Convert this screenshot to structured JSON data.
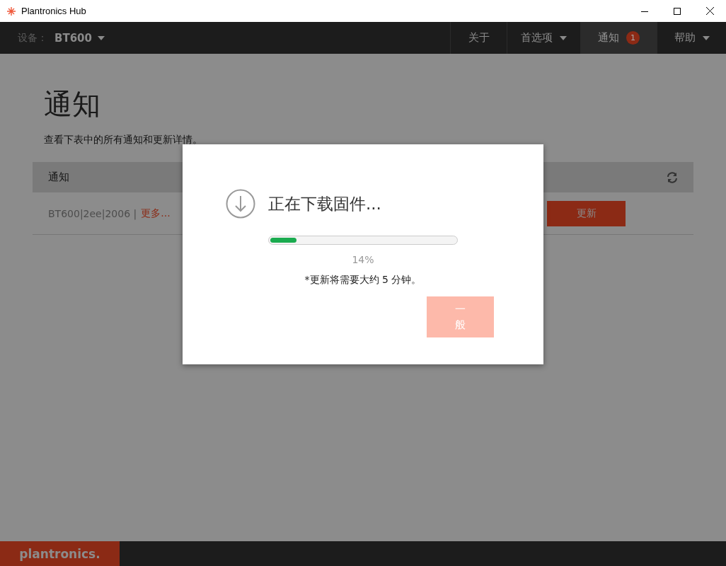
{
  "window": {
    "title": "Plantronics Hub"
  },
  "nav": {
    "device_label": "设备：",
    "device": "BT600",
    "menus": [
      {
        "label": "关于",
        "dropdown": false,
        "selected": false
      },
      {
        "label": "首选项",
        "dropdown": true,
        "selected": false
      },
      {
        "label": "通知",
        "dropdown": false,
        "selected": true,
        "badge": "1"
      },
      {
        "label": "帮助",
        "dropdown": true,
        "selected": false
      }
    ]
  },
  "page": {
    "title": "通知",
    "description": "查看下表中的所有通知和更新详情。"
  },
  "table": {
    "header": "通知",
    "rows": [
      {
        "info": "BT600|2ee|2006 |",
        "link": "更多...",
        "button": "更新"
      }
    ]
  },
  "dialog": {
    "title": "正在下载固件...",
    "progress": {
      "level": 0.14
    },
    "percent": "14%",
    "note": "*更新将需要大约 5 分钟。",
    "button": "一般"
  },
  "footer": {
    "logo": "plantronics."
  }
}
